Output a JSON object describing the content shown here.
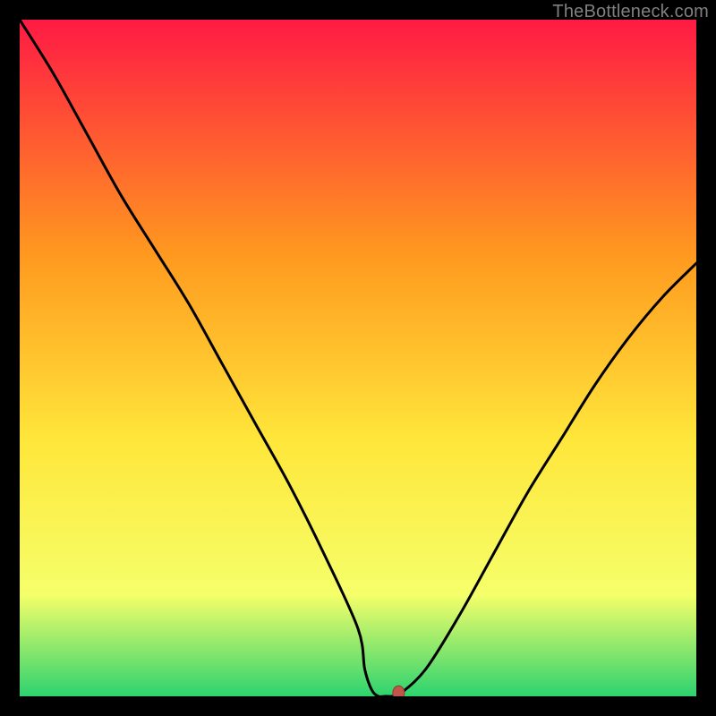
{
  "watermark": "TheBottleneck.com",
  "colors": {
    "page_bg": "#000000",
    "gradient_top": "#ff1a44",
    "gradient_mid1": "#ff9a1f",
    "gradient_mid2": "#ffe63a",
    "gradient_mid3": "#f5ff6a",
    "gradient_bottom": "#2dd36f",
    "curve": "#000000",
    "marker_fill": "#c0564b",
    "marker_stroke": "#8e3a30"
  },
  "chart_data": {
    "type": "line",
    "title": "",
    "xlabel": "",
    "ylabel": "",
    "xlim": [
      0,
      100
    ],
    "ylim": [
      0,
      100
    ],
    "grid": false,
    "legend": false,
    "x": [
      0,
      5,
      10,
      15,
      20,
      25,
      30,
      35,
      40,
      45,
      50,
      51,
      52,
      53,
      54,
      55,
      56,
      60,
      65,
      70,
      75,
      80,
      85,
      90,
      95,
      100
    ],
    "values": [
      100,
      92,
      83,
      74,
      66,
      58,
      49,
      40,
      31,
      21,
      10,
      4,
      1,
      0,
      0,
      0,
      0.2,
      4,
      12,
      21,
      30,
      38,
      46,
      53,
      59,
      64
    ],
    "marker": {
      "x": 56,
      "y": 0.5
    },
    "knee_x": 25
  }
}
